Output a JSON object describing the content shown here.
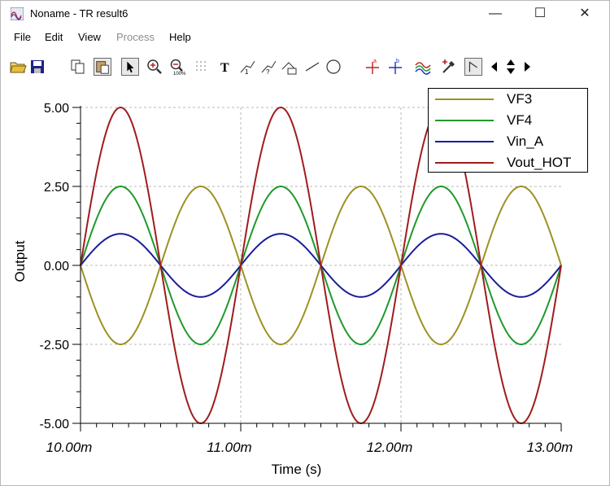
{
  "window": {
    "title": "Noname - TR result6",
    "minimize": "—",
    "maximize": "☐",
    "close": "✕"
  },
  "menu": [
    {
      "label": "File",
      "enabled": true
    },
    {
      "label": "Edit",
      "enabled": true
    },
    {
      "label": "View",
      "enabled": true
    },
    {
      "label": "Process",
      "enabled": false
    },
    {
      "label": "Help",
      "enabled": true
    }
  ],
  "toolbar": {
    "icons": [
      "open-icon",
      "save-icon",
      "copy-icon",
      "paste-icon",
      "select-arrow-icon",
      "zoom-in-icon",
      "zoom-100-icon",
      "grid-icon",
      "text-tool-icon",
      "label-tool-icon",
      "label-tool-2-icon",
      "annotation-icon",
      "line-tool-icon",
      "circle-tool-icon",
      "cursor-a-icon",
      "cursor-b-icon",
      "curves-icon",
      "probe-icon",
      "marker-icon",
      "nav-left-icon",
      "nav-updown-icon",
      "nav-right-icon"
    ]
  },
  "colors": {
    "VF3": "#9b9222",
    "VF4": "#1e9a2a",
    "Vin_A": "#1c1c9c",
    "Vout_HOT": "#a01c1c"
  },
  "chart_data": {
    "type": "line",
    "xlabel": "Time (s)",
    "ylabel": "Output",
    "xlim": [
      0.01,
      0.013
    ],
    "ylim": [
      -5,
      5
    ],
    "xticks": [
      0.01,
      0.011,
      0.012,
      0.013
    ],
    "xtick_labels": [
      "10.00m",
      "11.00m",
      "12.00m",
      "13.00m"
    ],
    "yticks": [
      5,
      2.5,
      0,
      -2.5,
      -5
    ],
    "ytick_labels": [
      "5.00",
      "2.50",
      "0.00",
      "-2.50",
      "-5.00"
    ],
    "grid": true,
    "legend_position": "top-right",
    "signal": {
      "frequency_hz": 1000,
      "waveform": "sine"
    },
    "series": [
      {
        "name": "VF3",
        "amplitude": -2.5,
        "color": "#9b9222"
      },
      {
        "name": "VF4",
        "amplitude": 2.5,
        "color": "#1e9a2a"
      },
      {
        "name": "Vin_A",
        "amplitude": 1.0,
        "color": "#1c1c9c"
      },
      {
        "name": "Vout_HOT",
        "amplitude": 5.0,
        "color": "#a01c1c"
      }
    ]
  }
}
